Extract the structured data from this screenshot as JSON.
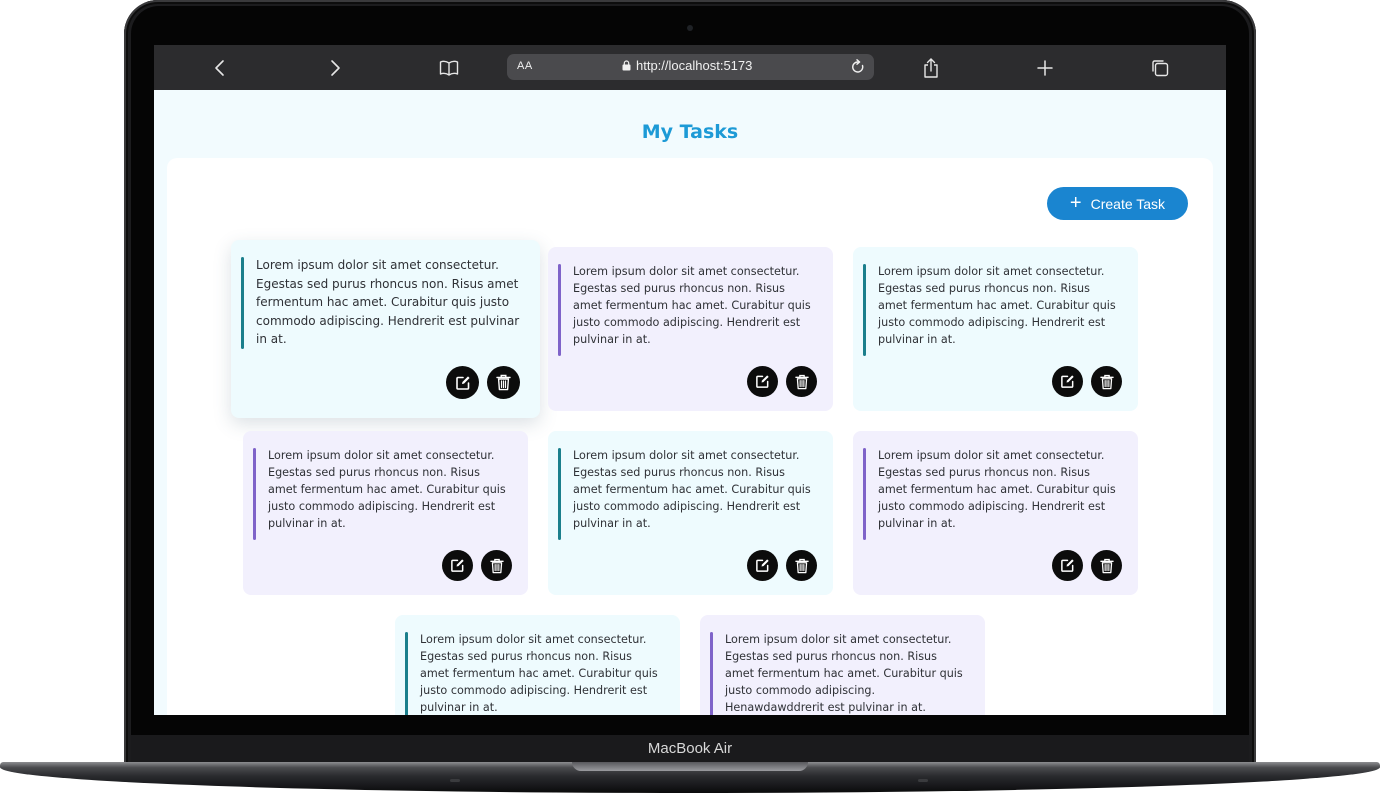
{
  "device": {
    "model_label": "MacBook Air"
  },
  "browser": {
    "text_size_label": "AA",
    "url": "http://localhost:5173",
    "icons": [
      "back-icon",
      "forward-icon",
      "bookmarks-icon",
      "lock-icon",
      "reload-icon",
      "share-icon",
      "new-tab-icon",
      "tabs-icon"
    ]
  },
  "app": {
    "title": "My Tasks",
    "create_button": {
      "plus": "+",
      "label": "Create Task"
    },
    "tasks": [
      {
        "text": "Lorem ipsum dolor sit amet consectetur. Egestas sed purus rhoncus non. Risus amet fermentum hac amet. Curabitur quis justo commodo adipiscing. Hendrerit est pulvinar in at.",
        "theme": "cyan",
        "state": "hovered"
      },
      {
        "text": "Lorem ipsum dolor sit amet consectetur. Egestas sed purus rhoncus non. Risus amet fermentum hac amet. Curabitur quis justo commodo adipiscing. Hendrerit est pulvinar in at.",
        "theme": "purple"
      },
      {
        "text": "Lorem ipsum dolor sit amet consectetur. Egestas sed purus rhoncus non. Risus amet fermentum hac amet. Curabitur quis justo commodo adipiscing. Hendrerit est pulvinar in at.",
        "theme": "cyan"
      },
      {
        "text": "Lorem ipsum dolor sit amet consectetur. Egestas sed purus rhoncus non. Risus amet fermentum hac amet. Curabitur quis justo commodo adipiscing. Hendrerit est pulvinar in at.",
        "theme": "purple"
      },
      {
        "text": "Lorem ipsum dolor sit amet consectetur. Egestas sed purus rhoncus non. Risus amet fermentum hac amet. Curabitur quis justo commodo adipiscing. Hendrerit est pulvinar in at.",
        "theme": "cyan"
      },
      {
        "text": "Lorem ipsum dolor sit amet consectetur. Egestas sed purus rhoncus non. Risus amet fermentum hac amet. Curabitur quis justo commodo adipiscing. Hendrerit est pulvinar in at.",
        "theme": "purple"
      },
      {
        "text": "Lorem ipsum dolor sit amet consectetur. Egestas sed purus rhoncus non. Risus amet fermentum hac amet. Curabitur quis justo commodo adipiscing. Hendrerit est pulvinar in at.",
        "theme": "cyan"
      },
      {
        "text": "Lorem ipsum dolor sit amet consectetur. Egestas sed purus rhoncus non. Risus amet fermentum hac amet. Curabitur quis justo commodo adipiscing. Henawdawddrerit est pulvinar in at.",
        "theme": "purple"
      }
    ],
    "task_actions": {
      "edit_icon": "edit-icon",
      "delete_icon": "trash-icon"
    }
  },
  "colors": {
    "title": "#1d9ad6",
    "create_button": "#1a85d0",
    "card_cyan": "#eefbfe",
    "card_purple": "#f2f0fd",
    "accent_cyan": "#1b7f8c",
    "accent_purple": "#7f63c9"
  }
}
